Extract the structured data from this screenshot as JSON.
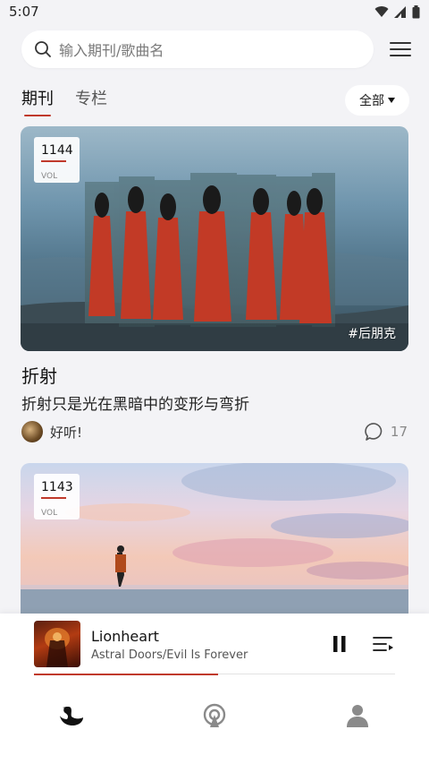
{
  "status_bar": {
    "time": "5:07"
  },
  "search": {
    "placeholder": "输入期刊/歌曲名"
  },
  "tabs": [
    {
      "label": "期刊",
      "active": true
    },
    {
      "label": "专栏",
      "active": false
    }
  ],
  "filter": {
    "label": "全部"
  },
  "cards": [
    {
      "vol_number": "1144",
      "vol_label": "VOL",
      "tag": "#后朋克",
      "title": "折射",
      "subtitle": "折射只是光在黑暗中的变形与弯折",
      "author": "好听!",
      "comments": "17"
    },
    {
      "vol_number": "1143",
      "vol_label": "VOL"
    }
  ],
  "player": {
    "track_title": "Lionheart",
    "track_artist": "Astral Doors/Evil Is Forever",
    "progress_fraction": 0.51
  },
  "icons": {
    "search": "search-icon",
    "menu": "hamburger-menu-icon",
    "dropdown": "caret-down-icon",
    "comment": "comment-bubble-icon",
    "pause": "pause-icon",
    "queue": "playlist-icon",
    "nav_home": "swan-logo-icon",
    "nav_radio": "radio-podcast-icon",
    "nav_profile": "person-icon"
  },
  "colors": {
    "accent": "#c0392b",
    "background": "#f3f3f6"
  }
}
